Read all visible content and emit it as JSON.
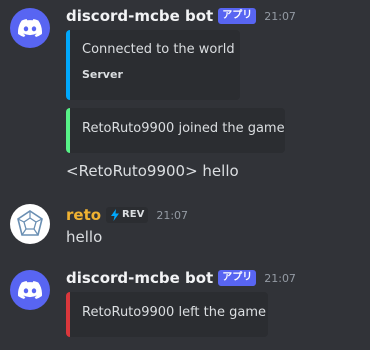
{
  "messages": [
    {
      "author": "discord-mcbe bot",
      "author_color": "#f2f3f5",
      "tag": "アプリ",
      "time": "21:07",
      "embeds": [
        {
          "title": "Connected to the world",
          "footer": "Server",
          "color": "#00a8fc"
        },
        {
          "title": "RetoRuto9900 joined the game",
          "color": "#57f287"
        }
      ],
      "text": "<RetoRuto9900> hello"
    },
    {
      "author": "reto",
      "author_color": "#f0b232",
      "badge": "REV",
      "time": "21:07",
      "text": "hello"
    },
    {
      "author": "discord-mcbe bot",
      "author_color": "#f2f3f5",
      "tag": "アプリ",
      "time": "21:07",
      "embeds": [
        {
          "title": "RetoRuto9900 left the game",
          "color": "#da373c"
        }
      ]
    }
  ],
  "icons": {
    "bot_avatar": "discord-logo-icon",
    "user_avatar": "dodecahedron-avatar-icon",
    "badge_icon": "lightning-icon"
  }
}
